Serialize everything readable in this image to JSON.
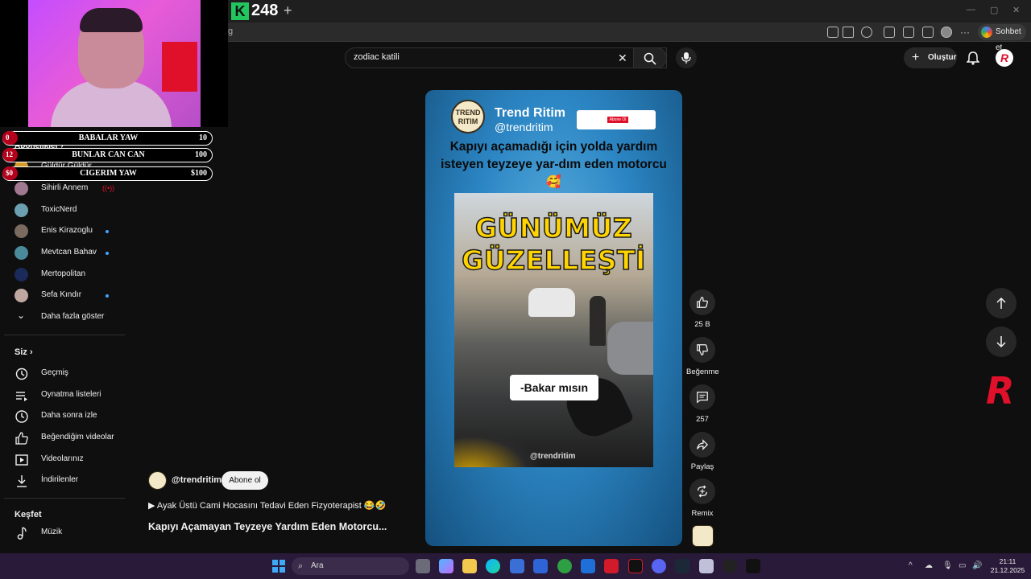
{
  "browser": {
    "tab_counter": "248",
    "tab_logo": "K",
    "new_tab_icon": "plus-icon",
    "address_fragment": "g",
    "chat_label": "Sohbet et"
  },
  "stream_overlay": {
    "bars": [
      {
        "badge": "0",
        "label": "BABALAR YAW",
        "value": "10"
      },
      {
        "badge": "12",
        "label": "BUNLAR CAN CAN",
        "value": "100"
      },
      {
        "badge": "$0",
        "label": "CIGERIM YAW",
        "value": "$100"
      }
    ]
  },
  "sidebar": {
    "subscriptions_header": "Abonelikler",
    "subscriptions": [
      {
        "name": "Güldür Güldür",
        "dot": false
      },
      {
        "name": "Sihirli Annem",
        "dot": false
      },
      {
        "name": "ToxicNerd",
        "dot": false
      },
      {
        "name": "Enis Kirazoglu",
        "dot": true
      },
      {
        "name": "Mevtcan Bahav",
        "dot": true
      },
      {
        "name": "Mertopolitan",
        "dot": false
      },
      {
        "name": "Sefa Kındır",
        "dot": true
      }
    ],
    "show_more": "Daha fazla göster",
    "you_header": "Siz",
    "you_items": [
      {
        "label": "Geçmiş",
        "icon": "history-icon"
      },
      {
        "label": "Oynatma listeleri",
        "icon": "playlist-icon"
      },
      {
        "label": "Daha sonra izle",
        "icon": "clock-icon"
      },
      {
        "label": "Beğendiğim videolar",
        "icon": "thumbs-up-icon"
      },
      {
        "label": "Videolarınız",
        "icon": "video-icon"
      },
      {
        "label": "İndirilenler",
        "icon": "download-icon"
      }
    ],
    "explore_header": "Keşfet",
    "explore_items": [
      {
        "label": "Müzik",
        "icon": "music-icon"
      }
    ]
  },
  "header": {
    "search_value": "zodiac katili",
    "create_label": "Oluştur"
  },
  "video": {
    "channel_name": "Trend Ritim",
    "channel_handle": "@trendritim",
    "logo_text": "TREND RITIM",
    "subscribe_tag": "Abone Ol",
    "headline": "Kapıyı açamadığı için yolda yardım isteyen teyzeye yar-dım eden motorcu 🥰",
    "title_line1": "GÜNÜMÜZ",
    "title_line2": "GÜZELLEŞTİ",
    "caption": "-Bakar mısın",
    "watermark": "@trendritim"
  },
  "actions": {
    "like_count": "25 B",
    "dislike_label": "Beğenme",
    "comment_count": "257",
    "share_label": "Paylaş",
    "remix_label": "Remix"
  },
  "channel_info": {
    "handle": "@trendritim",
    "subscribe_label": "Abone ol",
    "playlist_text": "▶ Ayak Üstü Cami Hocasını Tedavi Eden Fizyoterapist 😂🤣",
    "video_title": "Kapıyı Açamayan Teyzeye Yardım Eden Motorcu..."
  },
  "taskbar": {
    "search_placeholder": "Ara",
    "time": "21:11",
    "date": "21.12.2025"
  },
  "colors": {
    "accent_red": "#e0102a",
    "yt_bg": "#0f0f0f",
    "highlight_yellow": "#ffd400"
  }
}
